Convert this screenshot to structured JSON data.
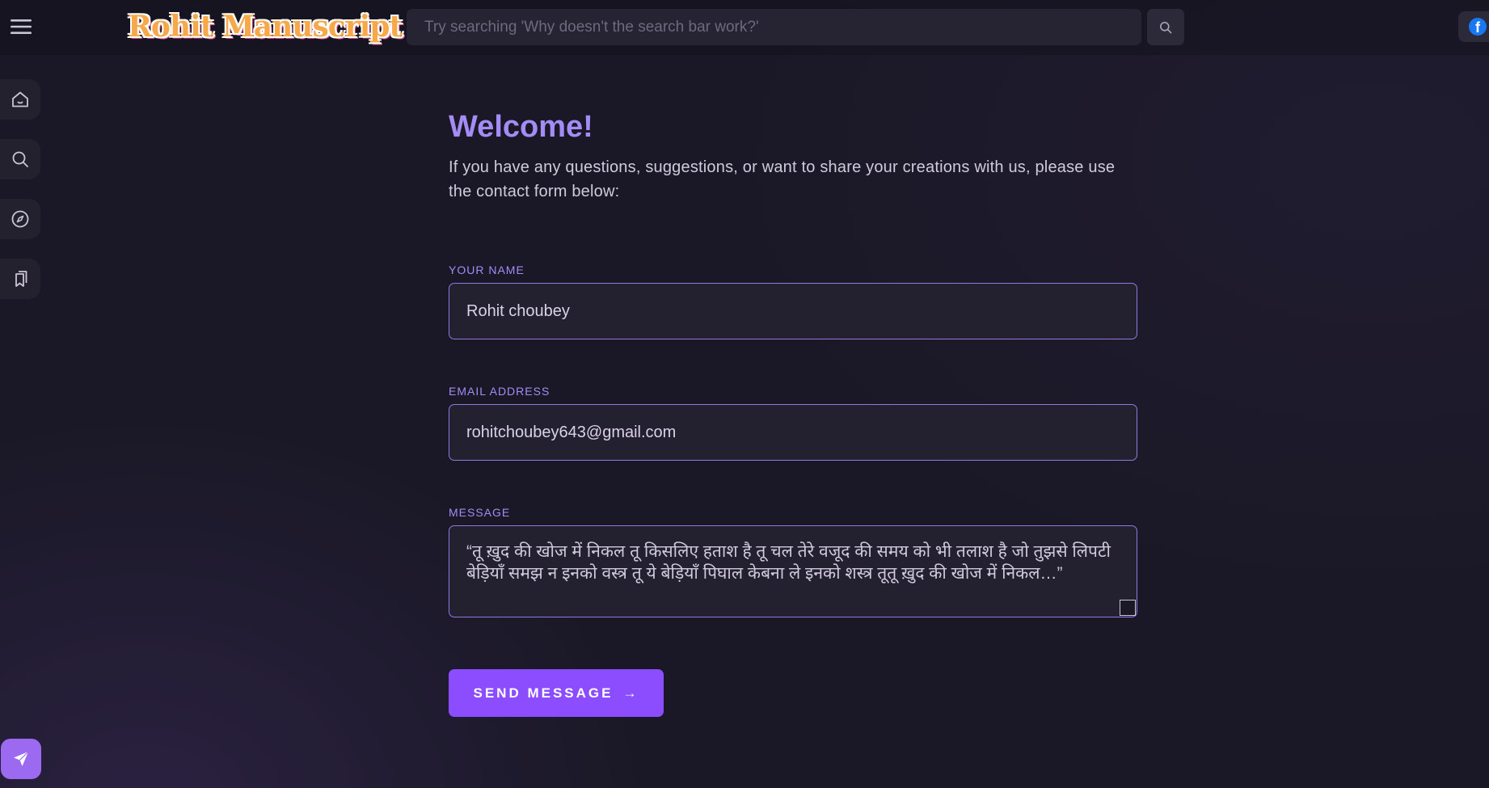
{
  "header": {
    "logo_text": "Rohit Manuscript",
    "search_placeholder": "Try searching 'Why doesn't the search bar work?'",
    "menu_icon": "hamburger-menu-icon",
    "search_icon": "search-icon",
    "social_icon": "facebook-icon"
  },
  "sidebar": {
    "items": [
      {
        "name": "home",
        "icon": "home-icon"
      },
      {
        "name": "search",
        "icon": "search-icon"
      },
      {
        "name": "explore",
        "icon": "compass-icon"
      },
      {
        "name": "bookmarks",
        "icon": "bookmarks-icon"
      }
    ],
    "fab_icon": "send-icon"
  },
  "main": {
    "title": "Welcome!",
    "intro": "If you have any questions, suggestions, or want to share your creations with us, please use the contact form below:",
    "form": {
      "name_label": "YOUR NAME",
      "name_value": "Rohit choubey",
      "email_label": "EMAIL ADDRESS",
      "email_value": "rohitchoubey643@gmail.com",
      "message_label": "MESSAGE",
      "message_value": "“तू ख़ुद की खोज में निकल तू किसलिए हताश है तू चल तेरे वजूद की समय को भी तलाश है जो तुझसे लिपटी बेड़ियाँ समझ न इनको वस्त्र तू ये बेड़ियाँ पिघाल केबना ले इनको शस्त्र तूतू ख़ुद की खोज में निकल…”",
      "submit_label": "SEND MESSAGE",
      "submit_arrow": "→"
    }
  },
  "colors": {
    "accent": "#a38cf5",
    "button": "#8b4dff",
    "background": "#1a1826",
    "field_border": "#8f7ae0"
  }
}
